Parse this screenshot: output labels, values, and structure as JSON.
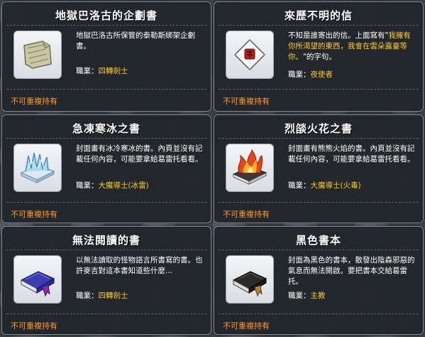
{
  "tooltips": [
    {
      "title": "地獄巴洛古的企劃書",
      "desc": "地獄巴洛古所保管的泰勒斯綁架企劃書。",
      "job_label": "職業：",
      "job_value": "四轉劍士",
      "restriction": "不可重複持有",
      "icon": "parchment-scroll-icon"
    },
    {
      "title": "來歷不明的信",
      "desc_before": "不知是誰寄出的信。上面寫有\"",
      "desc_highlight": "我擁有你所渴望的東西，我會在雲朵露臺等你。",
      "desc_after": "\"的字句。",
      "job_label": "職業：",
      "job_value": "夜使者",
      "restriction": "不可重複持有",
      "icon": "sealed-letter-icon"
    },
    {
      "title": "急凍寒冰之書",
      "desc": "封面畫有冰冷寒冰的書。內頁並沒有記載任何內容，可能要拿給葛雷托看看。",
      "job_label": "職業：",
      "job_value": "大魔導士(冰雷)",
      "restriction": "不可重複持有",
      "icon": "ice-book-icon"
    },
    {
      "title": "烈燄火花之書",
      "desc": "封面畫有熊熊火焰的書。內頁並沒有記載任何內容，可能要拿給葛雷托看看。",
      "job_label": "職業：",
      "job_value": "大魔導士(火毒)",
      "restriction": "不可重複持有",
      "icon": "fire-book-icon"
    },
    {
      "title": "無法閱讀的書",
      "desc": "以無法讀取的怪物語言所書寫的書。也許麥吉對這本書知道些什麼...",
      "job_label": "職業：",
      "job_value": "四轉劍士",
      "restriction": "不可重複持有",
      "icon": "blue-book-icon"
    },
    {
      "title": "黑色書本",
      "desc": "封面為黑色的書本，散發出陰森邪惡的氣息而無法開啟。要把書本交給葛雷托。",
      "job_label": "職業：",
      "job_value": "主教",
      "restriction": "不可重複持有",
      "icon": "black-book-icon"
    }
  ]
}
